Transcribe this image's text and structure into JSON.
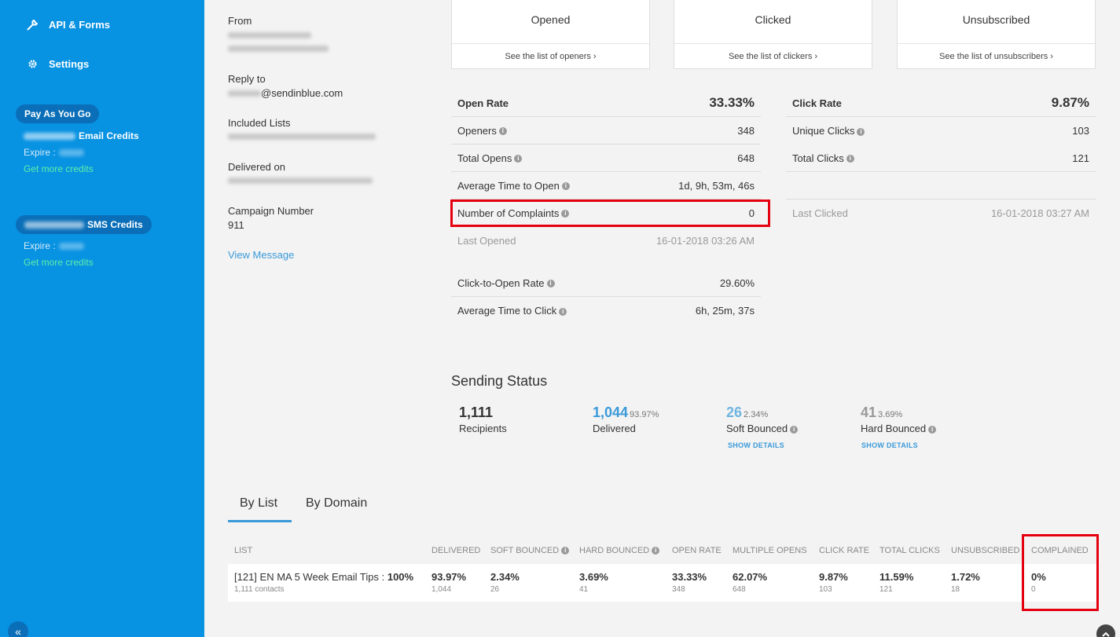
{
  "sidebar": {
    "nav": [
      {
        "label": "API & Forms",
        "icon": "wrench-icon"
      },
      {
        "label": "Settings",
        "icon": "gear-icon"
      }
    ],
    "plan": "Pay As You Go",
    "email_credits_label": "Email Credits",
    "sms_credits_label": "SMS Credits",
    "expire_label": "Expire :",
    "get_more_credits": "Get more credits",
    "collapse_glyph": "«"
  },
  "info": {
    "from_label": "From",
    "reply_to_label": "Reply to",
    "reply_to_domain": "@sendinblue.com",
    "included_lists_label": "Included Lists",
    "delivered_on_label": "Delivered on",
    "campaign_number_label": "Campaign Number",
    "campaign_number": "911",
    "view_message": "View Message"
  },
  "cards": [
    {
      "label": "Opened",
      "link": "See the list of openers ›",
      "color": "#2d9fdc"
    },
    {
      "label": "Clicked",
      "link": "See the list of clickers ›",
      "color": "#16b77c"
    },
    {
      "label": "Unsubscribed",
      "link": "See the list of unsubscribers ›",
      "color": "#f5a623"
    }
  ],
  "open_stats": {
    "header_label": "Open Rate",
    "header_value": "33.33%",
    "rows": [
      {
        "label": "Openers",
        "value": "348"
      },
      {
        "label": "Total Opens",
        "value": "648"
      },
      {
        "label": "Average Time to Open",
        "value": "1d, 9h, 53m, 46s"
      },
      {
        "label": "Number of Complaints",
        "value": "0"
      }
    ],
    "last_opened_label": "Last Opened",
    "last_opened_value": "16-01-2018 03:26 AM",
    "cto_label": "Click-to-Open Rate",
    "cto_value": "29.60%",
    "avg_click_label": "Average Time to Click",
    "avg_click_value": "6h, 25m, 37s"
  },
  "click_stats": {
    "header_label": "Click Rate",
    "header_value": "9.87%",
    "rows": [
      {
        "label": "Unique Clicks",
        "value": "103"
      },
      {
        "label": "Total Clicks",
        "value": "121"
      }
    ],
    "last_clicked_label": "Last Clicked",
    "last_clicked_value": "16-01-2018 03:27 AM"
  },
  "sending_status": {
    "title": "Sending Status",
    "items": [
      {
        "num": "1,111",
        "pct": "",
        "label": "Recipients",
        "link": ""
      },
      {
        "num": "1,044",
        "pct": "93.97%",
        "label": "Delivered",
        "link": ""
      },
      {
        "num": "26",
        "pct": "2.34%",
        "label": "Soft Bounced",
        "link": "SHOW DETAILS"
      },
      {
        "num": "41",
        "pct": "3.69%",
        "label": "Hard Bounced",
        "link": "SHOW DETAILS"
      }
    ]
  },
  "tabs": [
    "By List",
    "By Domain"
  ],
  "table": {
    "headers": [
      "LIST",
      "DELIVERED",
      "SOFT BOUNCED",
      "HARD BOUNCED",
      "OPEN RATE",
      "MULTIPLE OPENS",
      "CLICK RATE",
      "TOTAL CLICKS",
      "UNSUBSCRIBED",
      "COMPLAINED"
    ],
    "row": {
      "list_name": "[121] EN MA 5 Week Email Tips : ",
      "list_pct": "100%",
      "list_sub": "1,111 contacts",
      "cells": [
        {
          "main": "93.97%",
          "sub": "1,044"
        },
        {
          "main": "2.34%",
          "sub": "26"
        },
        {
          "main": "3.69%",
          "sub": "41"
        },
        {
          "main": "33.33%",
          "sub": "348"
        },
        {
          "main": "62.07%",
          "sub": "648"
        },
        {
          "main": "9.87%",
          "sub": "103"
        },
        {
          "main": "11.59%",
          "sub": "121"
        },
        {
          "main": "1.72%",
          "sub": "18"
        },
        {
          "main": "0%",
          "sub": "0"
        }
      ]
    }
  }
}
